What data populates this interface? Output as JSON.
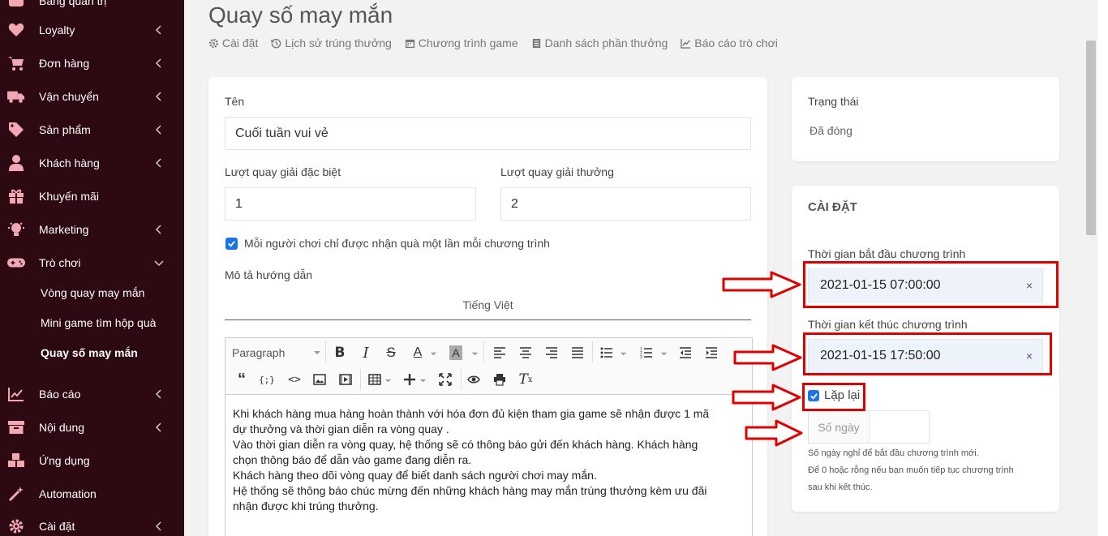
{
  "sidebar": {
    "partial_top": "Bảng quản trị",
    "items": [
      {
        "label": "Loyalty",
        "icon": "heart-icon"
      },
      {
        "label": "Đơn hàng",
        "icon": "cart-icon"
      },
      {
        "label": "Vận chuyển",
        "icon": "truck-icon"
      },
      {
        "label": "Sản phẩm",
        "icon": "tag-icon"
      },
      {
        "label": "Khách hàng",
        "icon": "user-icon"
      },
      {
        "label": "Khuyến mãi",
        "icon": "gift-icon"
      },
      {
        "label": "Marketing",
        "icon": "lightbulb-icon"
      },
      {
        "label": "Trò chơi",
        "icon": "gamepad-icon"
      }
    ],
    "sub_items": [
      {
        "label": "Vòng quay may mắn"
      },
      {
        "label": "Mini game tìm hộp quà"
      },
      {
        "label": "Quay số may mắn"
      }
    ],
    "items_bottom": [
      {
        "label": "Báo cáo",
        "icon": "chart-icon"
      },
      {
        "label": "Nội dung",
        "icon": "archive-icon"
      },
      {
        "label": "Ứng dụng",
        "icon": "cubes-icon"
      },
      {
        "label": "Automation",
        "icon": "magic-icon"
      },
      {
        "label": "Cài đặt",
        "icon": "gear-icon"
      }
    ]
  },
  "page": {
    "title": "Quay số may mắn",
    "tabs": [
      {
        "label": "Cài đặt",
        "icon": "gear-icon"
      },
      {
        "label": "Lịch sử trúng thưởng",
        "icon": "history-icon"
      },
      {
        "label": "Chương trình game",
        "icon": "calendar-icon"
      },
      {
        "label": "Danh sách phần thưởng",
        "icon": "list-icon"
      },
      {
        "label": "Báo cáo trò chơi",
        "icon": "chart-icon"
      }
    ]
  },
  "form": {
    "name_label": "Tên",
    "name_value": "Cuối tuần vui vẻ",
    "special_label": "Lượt quay giải đặc biệt",
    "special_value": "1",
    "prize_label": "Lượt quay giải thưởng",
    "prize_value": "2",
    "once_label": "Mỗi người chơi chỉ được nhận quà một lần mỗi chương trình",
    "desc_label": "Mô tả hướng dẫn",
    "lang_tab": "Tiếng Việt",
    "paragraph_select": "Paragraph",
    "editor_lines": [
      "Khi khách hàng mua hàng hoàn thành với hóa đơn đủ kiện tham gia game sẽ nhận được 1 mã",
      "dự thưởng và thời gian diễn ra vòng quay .",
      "Vào thời gian diễn ra vòng quay, hệ thống sẽ có thông báo gửi đến khách hàng. Khách hàng",
      "chọn thông báo để dẫn vào game đang diễn ra.",
      "Khách hàng theo dõi vòng quay để biết danh sách người chơi may mắn.",
      "Hệ thống sẽ thông báo chúc mừng đến những khách hàng may mắn trúng thưởng kèm ưu đãi",
      "nhận được khi trúng thưởng."
    ]
  },
  "status": {
    "label": "Trạng thái",
    "value": "Đã đóng"
  },
  "settings": {
    "title": "CÀI ĐẶT",
    "start_label": "Thời gian bắt đầu chương trình",
    "start_value": "2021-01-15 07:00:00",
    "end_label": "Thời gian kết thúc chương trình",
    "end_value": "2021-01-15 17:50:00",
    "clear_glyph": "×",
    "repeat_label": "Lặp lại",
    "days_addon": "Số ngày",
    "days_value": "",
    "help_1": "Số ngày nghỉ để bắt đầu chương trình mới.",
    "help_2": "Để 0 hoặc rỗng nếu bạn muốn tiếp tục chương trình",
    "help_3": "sau khi kết thúc."
  },
  "colors": {
    "sidebar_bg": "#2d0a12",
    "accent": "#1a73e8",
    "annotation_red": "#e00000"
  }
}
